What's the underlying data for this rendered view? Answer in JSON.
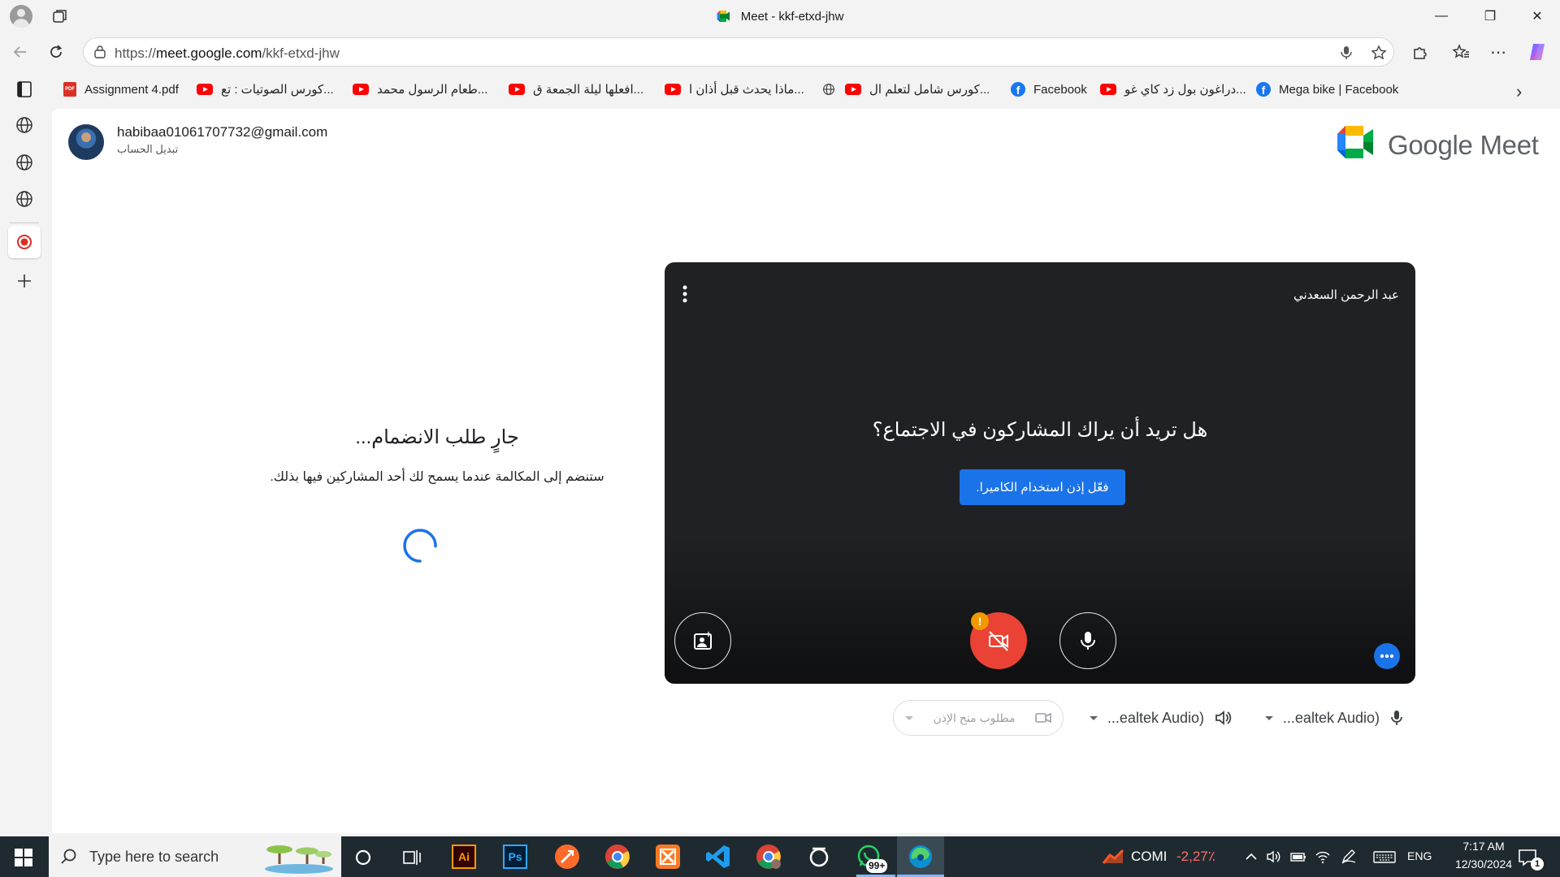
{
  "window": {
    "title": "Meet - kkf-etxd-jhw",
    "minimize": "—",
    "maximize": "❐",
    "close": "✕"
  },
  "address_bar": {
    "url_prefix": "https://",
    "url_host": "meet.google.com",
    "url_path": "/kkf-etxd-jhw"
  },
  "bookmarks": [
    {
      "label": "Assignment 4.pdf",
      "icon": "pdf"
    },
    {
      "label": "كورس الصوتيات : تع...",
      "icon": "youtube"
    },
    {
      "label": "طعام الرسول محمد...",
      "icon": "youtube"
    },
    {
      "label": "افعلها ليلة الجمعة ق...",
      "icon": "youtube"
    },
    {
      "label": "ماذا يحدث قبل أذان ا...",
      "icon": "youtube"
    },
    {
      "label": "كورس شامل لتعلم ال...",
      "icon": "globe"
    },
    {
      "label": "Facebook",
      "icon": "facebook"
    },
    {
      "label": "دراغون بول زد كاي غو...",
      "icon": "youtube"
    },
    {
      "label": "Mega bike | Facebook",
      "icon": "facebook"
    }
  ],
  "account": {
    "email": "habibaa01061707732@gmail.com",
    "switch_label": "تبديل الحساب"
  },
  "brand": {
    "name": "Google Meet"
  },
  "join": {
    "title": "جارٍ طلب الانضمام...",
    "subtitle": "ستنضم إلى المكالمة عندما يسمح لك أحد المشاركين فيها بذلك."
  },
  "preview": {
    "participant_name": "عبد الرحمن السعدني",
    "question": "هل تريد أن يراك المشاركون في الاجتماع؟",
    "allow_button": "فعّل إذن استخدام الكاميرا."
  },
  "devices": {
    "camera_placeholder": "مطلوب منح الإذن",
    "speaker_label": "...ealtek Audio)",
    "mic_label": "...ealtek Audio)"
  },
  "taskbar": {
    "search_placeholder": "Type here to search",
    "whatsapp_badge": "99+",
    "stock_name": "COMI",
    "stock_change": "-2,27٪",
    "language": "ENG",
    "time": "7:17 AM",
    "date": "12/30/2024",
    "notifications_badge": "1"
  },
  "colors": {
    "accent_blue": "#1a73e8",
    "camera_off_red": "#ea4335",
    "warning_orange": "#f29900",
    "preview_bg": "#202124",
    "stock_down": "#ff6b6b"
  }
}
